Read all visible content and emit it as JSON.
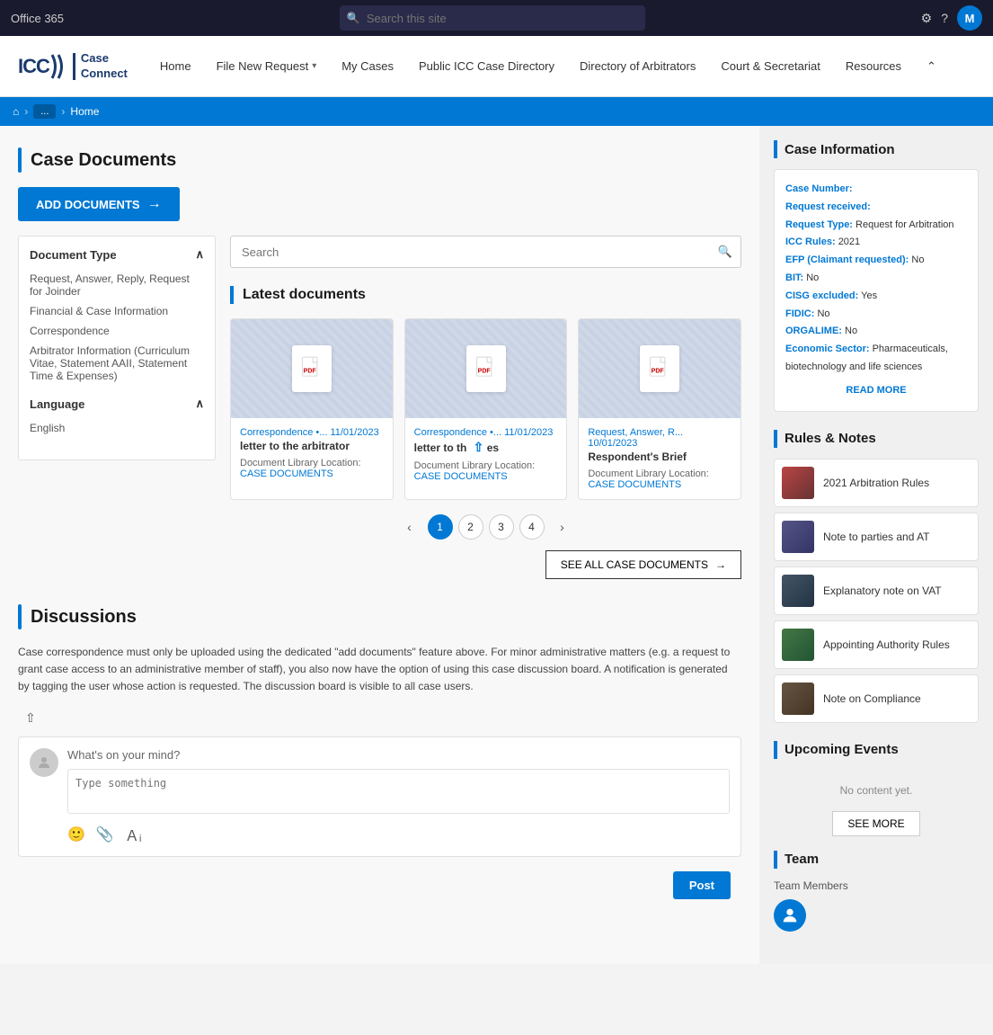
{
  "office_bar": {
    "title": "Office 365",
    "search_placeholder": "Search this site",
    "avatar_letter": "M"
  },
  "nav": {
    "logo_icc": "ICC",
    "logo_app": "Case\nConnect",
    "links": [
      {
        "label": "Home",
        "has_chevron": false
      },
      {
        "label": "File New Request",
        "has_chevron": true
      },
      {
        "label": "My Cases",
        "has_chevron": false
      },
      {
        "label": "Public ICC Case Directory",
        "has_chevron": false
      },
      {
        "label": "Directory of Arbitrators",
        "has_chevron": false
      },
      {
        "label": "Court & Secretariat",
        "has_chevron": false
      },
      {
        "label": "Resources",
        "has_chevron": false
      }
    ]
  },
  "breadcrumb": {
    "home_icon": "⌂",
    "crumb_pill": "...",
    "crumb_home": "Home"
  },
  "case_documents": {
    "section_title": "Case Documents",
    "add_btn_label": "ADD DOCUMENTS",
    "search_placeholder": "Search",
    "latest_title": "Latest documents",
    "cards": [
      {
        "type_label": "Correspondence •... 11/01/2023",
        "title": "letter to the arbitrator",
        "location_label": "Document Library Location:",
        "location_link": "CASE DOCUMENTS"
      },
      {
        "type_label": "Correspondence •... 11/01/2023",
        "title": "letter to th",
        "location_label": "Document Library Location:",
        "location_link": "CASE DOCUMENTS"
      },
      {
        "type_label": "Request, Answer, R... 10/01/2023",
        "title": "Respondent's Brief",
        "location_label": "Document Library Location:",
        "location_link": "CASE DOCUMENTS"
      }
    ],
    "pagination": [
      "1",
      "2",
      "3",
      "4"
    ],
    "see_all_label": "SEE ALL CASE DOCUMENTS"
  },
  "filters": {
    "document_type_label": "Document Type",
    "type_items": [
      "Request, Answer, Reply, Request for Joinder",
      "Financial & Case Information",
      "Correspondence",
      "Arbitrator Information (Curriculum Vitae, Statement AAII, Statement Time & Expenses)"
    ],
    "language_label": "Language",
    "language_items": [
      "English"
    ]
  },
  "discussions": {
    "section_title": "Discussions",
    "body_text": "Case correspondence must only be uploaded using the dedicated \"add documents\" feature above. For minor administrative matters (e.g. a request to grant case access to an administrative member of staff), you also now have the option of using this case discussion board. A notification is generated by tagging the user whose action is requested. The discussion board is visible to all case users.",
    "what_on_mind": "What's on your mind?",
    "type_placeholder": "Type something",
    "post_btn_label": "Post"
  },
  "case_info": {
    "section_title": "Case Information",
    "case_number_label": "Case Number:",
    "case_number_value": "",
    "request_received_label": "Request received:",
    "request_received_value": "",
    "request_type_label": "Request Type:",
    "request_type_value": "Request for Arbitration",
    "icc_rules_label": "ICC Rules:",
    "icc_rules_value": "2021",
    "efp_label": "EFP (Claimant requested):",
    "efp_value": "No",
    "bit_label": "BIT:",
    "bit_value": "No",
    "cisg_label": "CISG excluded:",
    "cisg_value": "Yes",
    "fidic_label": "FIDIC:",
    "fidic_value": "No",
    "orgalime_label": "ORGALIME:",
    "orgalime_value": "No",
    "economic_sector_label": "Economic Sector:",
    "economic_sector_value": "Pharmaceuticals, biotechnology and life sciences",
    "read_more_label": "READ MORE"
  },
  "rules_notes": {
    "section_title": "Rules & Notes",
    "items": [
      {
        "label": "2021 Arbitration Rules"
      },
      {
        "label": "Note to parties and AT"
      },
      {
        "label": "Explanatory note on VAT"
      },
      {
        "label": "Appointing Authority Rules"
      },
      {
        "label": "Note on Compliance"
      }
    ]
  },
  "upcoming_events": {
    "section_title": "Upcoming Events",
    "no_content": "No content yet.",
    "see_more_label": "SEE MORE"
  },
  "team": {
    "section_title": "Team",
    "members_label": "Team Members"
  }
}
